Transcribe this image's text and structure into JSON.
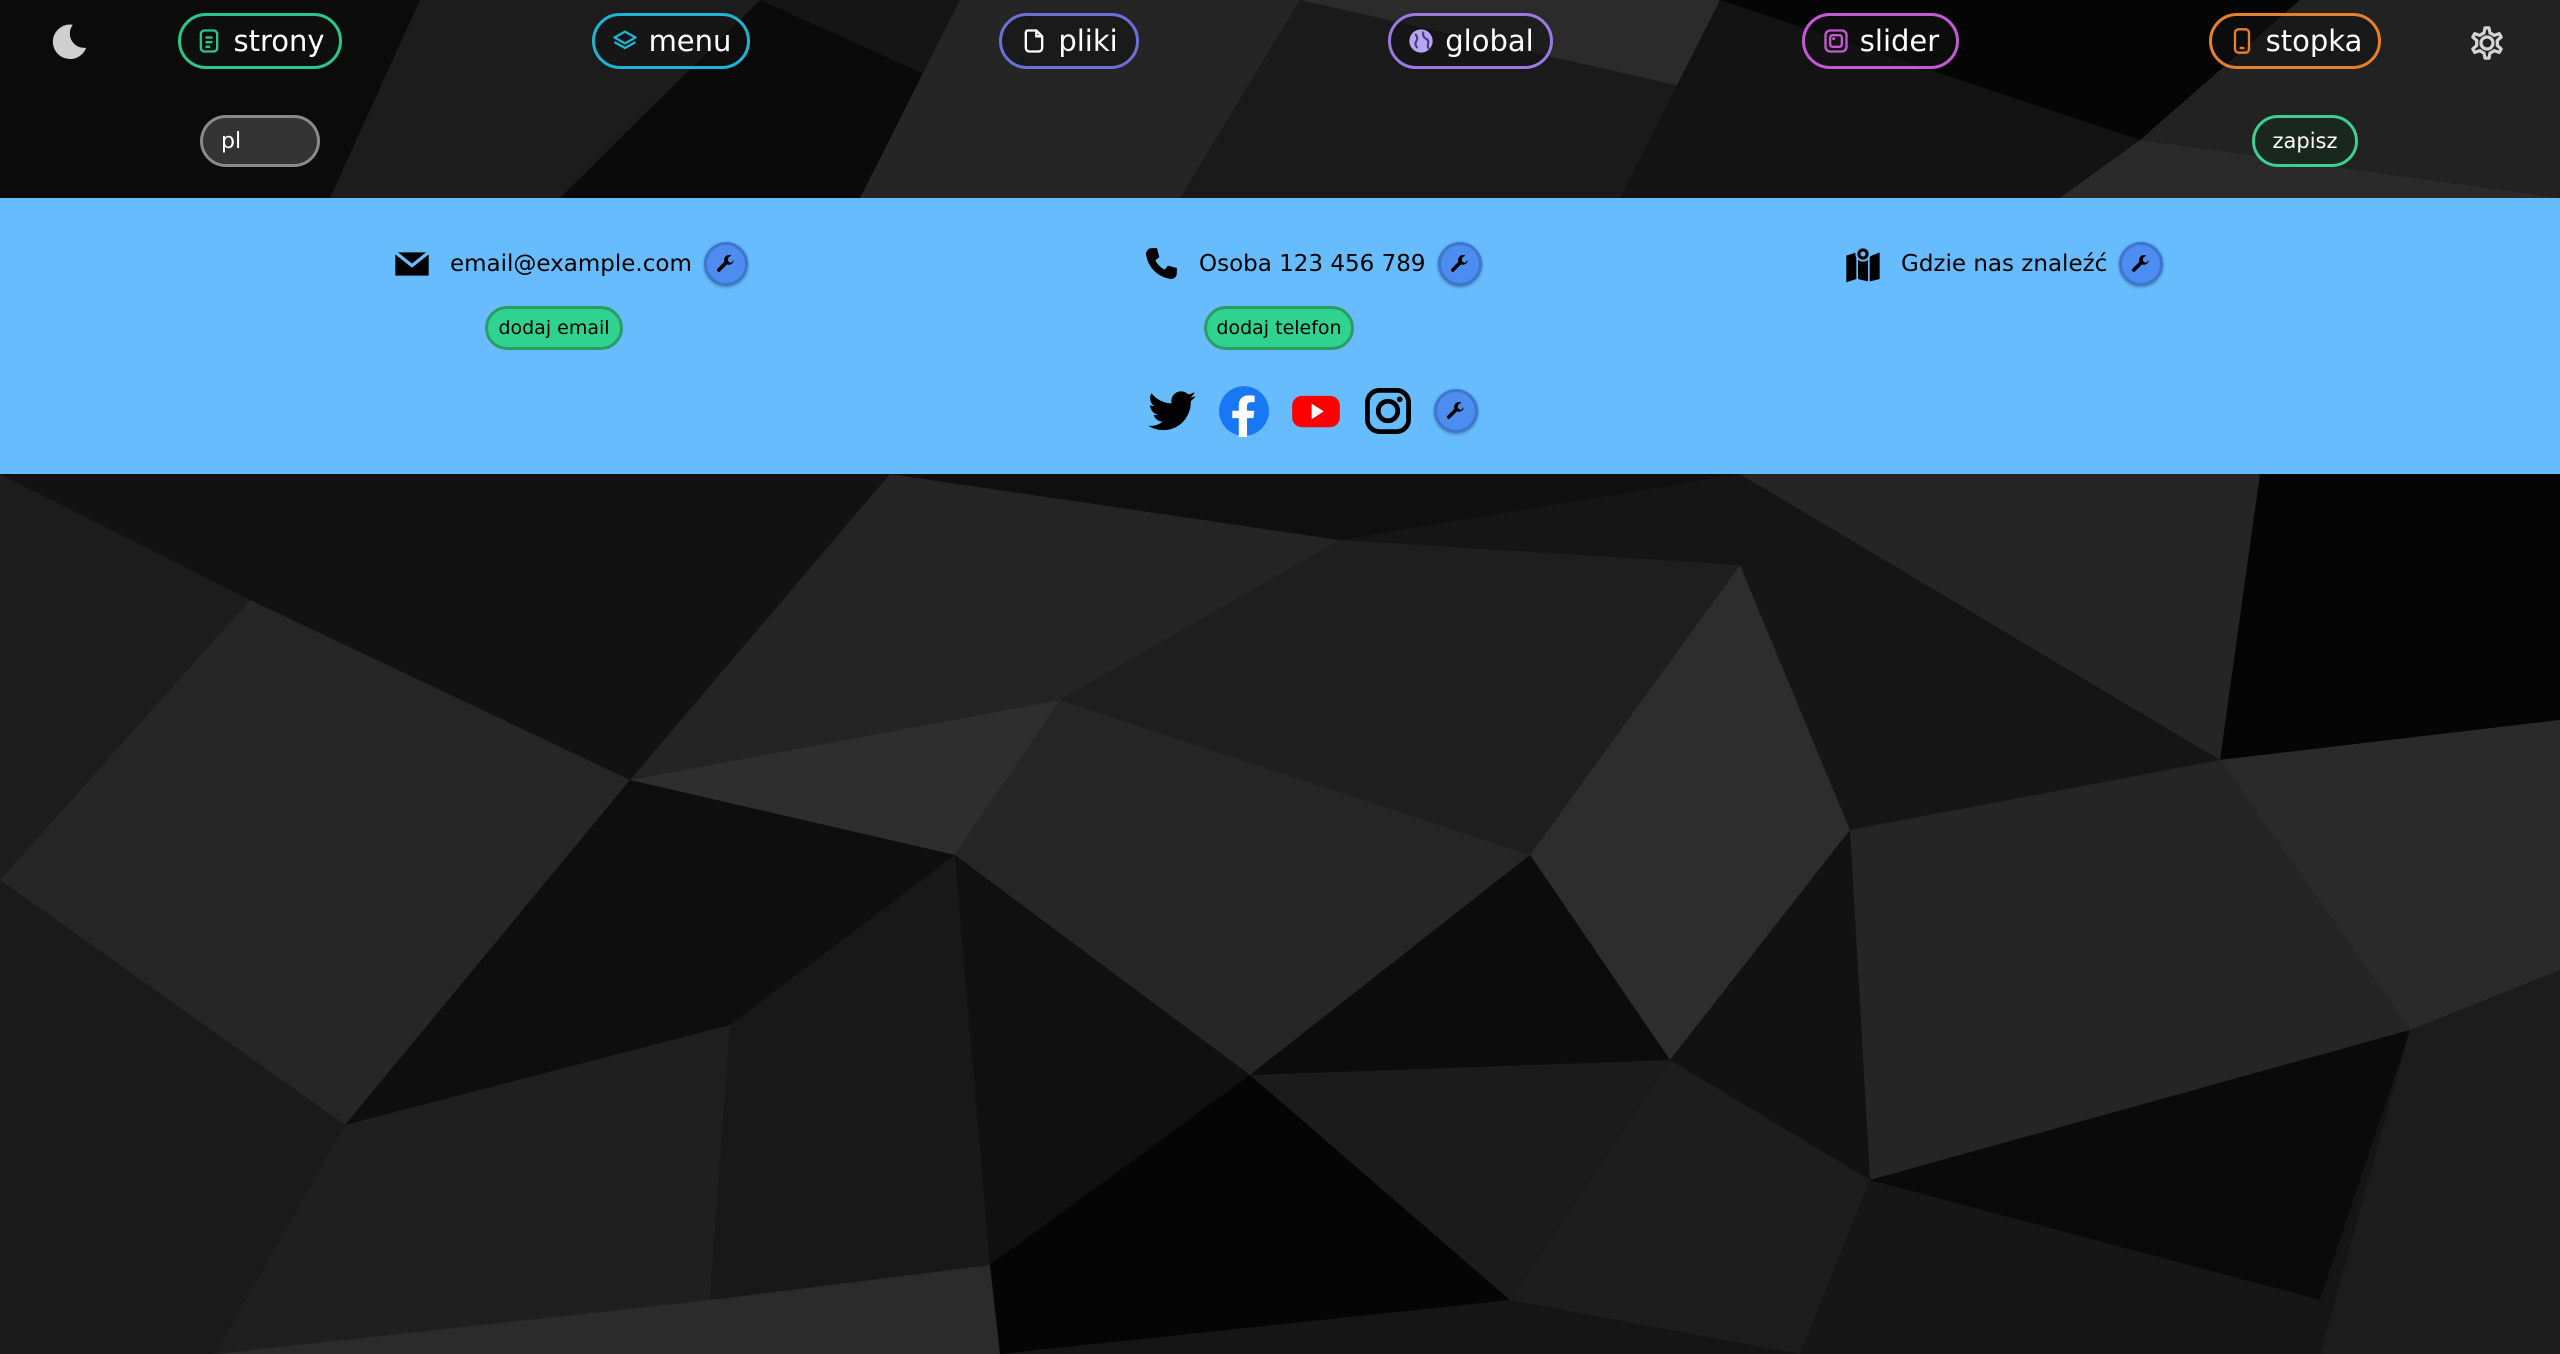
{
  "nav": {
    "strony": {
      "label": "strony",
      "color": "#29c88a"
    },
    "menu": {
      "label": "menu",
      "color": "#1fb4d1"
    },
    "pliki": {
      "label": "pliki",
      "color": "#6b6fd8"
    },
    "global": {
      "label": "global",
      "color": "#9a79e0"
    },
    "slider": {
      "label": "slider",
      "color": "#c45ad3"
    },
    "stopka": {
      "label": "stopka",
      "color": "#e5812c"
    }
  },
  "top": {
    "theme_icon": "moon-icon",
    "settings_icon": "gear-icon",
    "language_value": "pl",
    "save_label": "zapisz"
  },
  "footer": {
    "background": "#66bcfc",
    "email": {
      "text": "email@example.com",
      "icon": "envelope-icon",
      "add_label": "dodaj email"
    },
    "phone": {
      "text": "Osoba 123 456 789",
      "icon": "phone-icon",
      "add_label": "dodaj telefon"
    },
    "location": {
      "text": "Gdzie nas znaleźć",
      "icon": "map-icon"
    },
    "social": [
      "twitter-icon",
      "facebook-icon",
      "youtube-icon",
      "instagram-icon"
    ],
    "edit_icon": "wrench-icon"
  }
}
